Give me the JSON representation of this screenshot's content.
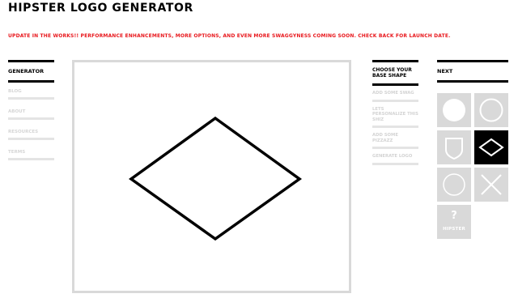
{
  "header": {
    "title": "HIPSTER LOGO GENERATOR",
    "announcement": "UPDATE IN THE WORKS!! PERFORMANCE ENHANCEMENTS, MORE OPTIONS, AND EVEN MORE SWAGGYNESS COMING SOON. CHECK BACK FOR LAUNCH DATE."
  },
  "nav": {
    "current": "GENERATOR",
    "items": [
      "BLOG",
      "ABOUT",
      "RESOURCES",
      "TERMS"
    ]
  },
  "steps": {
    "current": "CHOOSE YOUR BASE SHAPE",
    "items": [
      "ADD SOME SWAG",
      "LETS PERSONALIZE THIS SHIZ",
      "ADD SOME PIZZAZZ",
      "GENERATE LOGO"
    ]
  },
  "next": {
    "label": "NEXT",
    "random_tile": {
      "symbol": "?",
      "label": "HIPSTER"
    }
  },
  "shapes": {
    "selected": "diamond-outline",
    "options": [
      "circle-filled",
      "circle-outline",
      "shield-outline",
      "diamond-outline",
      "circle-thin-outline",
      "x-lines"
    ]
  },
  "colors": {
    "accent": "#e8171c",
    "tile": "#d9d9d9",
    "selected_tile": "#000000"
  }
}
